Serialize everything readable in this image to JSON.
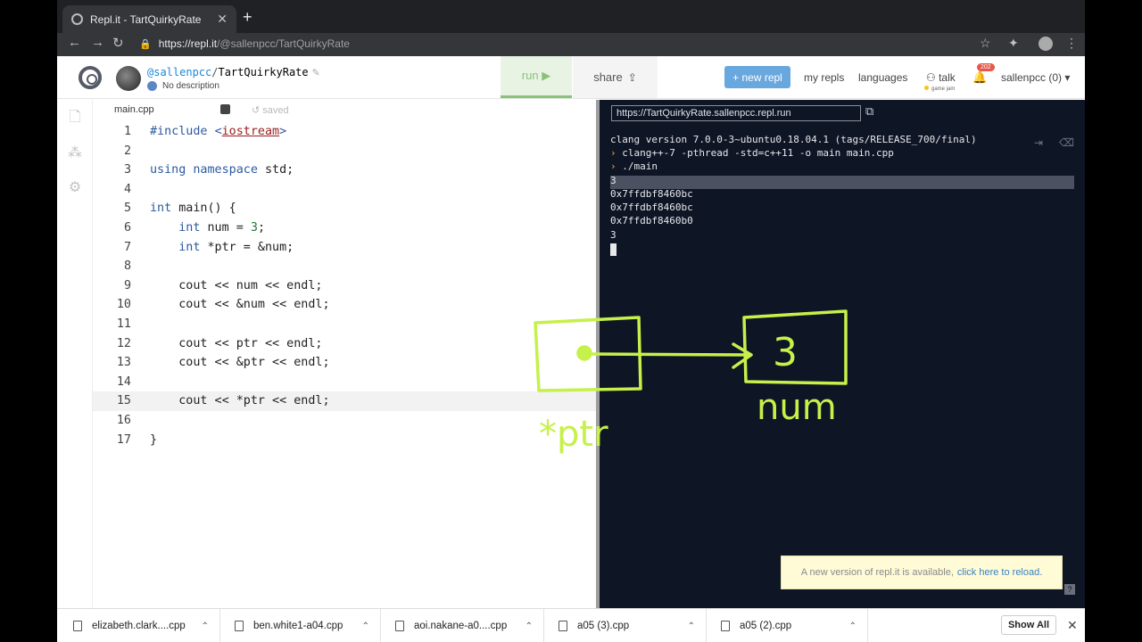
{
  "browser": {
    "tab_title": "Repl.it - TartQuirkyRate",
    "url_host": "https://repl.it",
    "url_path": "/@sallenpcc/TartQuirkyRate"
  },
  "repl": {
    "user": "@sallenpcc",
    "name": "TartQuirkyRate",
    "description": "No description",
    "run_label": "run ▶",
    "share_label": "share"
  },
  "header_nav": {
    "new_repl": "+ new repl",
    "my_repls": "my repls",
    "languages": "languages",
    "talk": "talk",
    "game_jam": "game jam",
    "notifications": "202",
    "account": "sallenpcc (0) ▾"
  },
  "editor": {
    "file_tab": "main.cpp",
    "saved_label": "saved",
    "active_line": 15,
    "lines": [
      {
        "n": "1",
        "text": "#include <iostream>"
      },
      {
        "n": "2",
        "text": ""
      },
      {
        "n": "3",
        "text": "using namespace std;"
      },
      {
        "n": "4",
        "text": ""
      },
      {
        "n": "5",
        "text": "int main() {"
      },
      {
        "n": "6",
        "text": "    int num = 3;"
      },
      {
        "n": "7",
        "text": "    int *ptr = &num;"
      },
      {
        "n": "8",
        "text": ""
      },
      {
        "n": "9",
        "text": "    cout << num << endl;"
      },
      {
        "n": "10",
        "text": "    cout << &num << endl;"
      },
      {
        "n": "11",
        "text": ""
      },
      {
        "n": "12",
        "text": "    cout << ptr << endl;"
      },
      {
        "n": "13",
        "text": "    cout << &ptr << endl;"
      },
      {
        "n": "14",
        "text": ""
      },
      {
        "n": "15",
        "text": "    cout << *ptr << endl;"
      },
      {
        "n": "16",
        "text": ""
      },
      {
        "n": "17",
        "text": "}"
      }
    ]
  },
  "console": {
    "url": "https://TartQuirkyRate.sallenpcc.repl.run",
    "lines": [
      {
        "prompt": "",
        "text": "clang version 7.0.0-3~ubuntu0.18.04.1 (tags/RELEASE_700/final)"
      },
      {
        "prompt": "›",
        "text": "clang++-7 -pthread -std=c++11 -o main main.cpp"
      },
      {
        "prompt": "›",
        "text": "./main"
      },
      {
        "prompt": "",
        "text": "3"
      },
      {
        "prompt": "",
        "text": "0x7ffdbf8460bc"
      },
      {
        "prompt": "",
        "text": "0x7ffdbf8460bc"
      },
      {
        "prompt": "",
        "text": "0x7ffdbf8460b0"
      },
      {
        "prompt": "",
        "text": "3"
      }
    ],
    "notice_text": "A new version of repl.it is available,",
    "notice_link": "click here to reload."
  },
  "annotation": {
    "ptr_label": "*ptr",
    "box_value": "3",
    "num_label": "num",
    "ink_color": "#c6f04a"
  },
  "downloads": {
    "items": [
      "elizabeth.clark....cpp",
      "ben.white1-a04.cpp",
      "aoi.nakane-a0....cpp",
      "a05 (3).cpp",
      "a05 (2).cpp"
    ],
    "show_all": "Show All"
  }
}
